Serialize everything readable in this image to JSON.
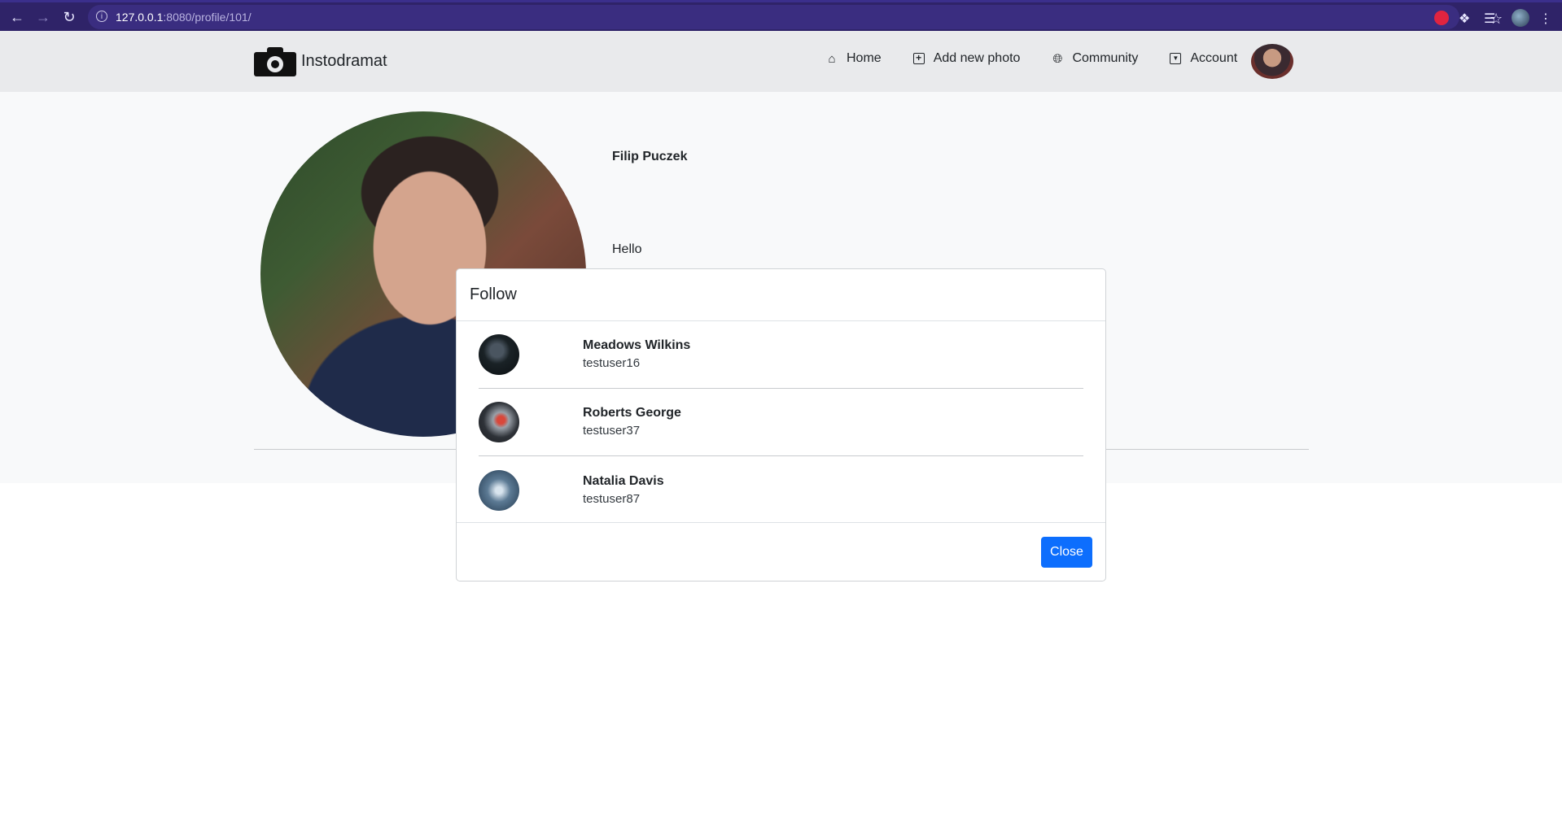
{
  "browser": {
    "url_host": "127.0.0.1",
    "url_rest": ":8080/profile/101/"
  },
  "site": {
    "brand": "Instodramat",
    "nav": {
      "home": "Home",
      "add_photo": "Add new photo",
      "community": "Community",
      "account": "Account"
    }
  },
  "profile": {
    "name": "Filip Puczek",
    "bio": "Hello"
  },
  "modal": {
    "title": "Follow",
    "users": [
      {
        "name": "Meadows Wilkins",
        "username": "testuser16"
      },
      {
        "name": "Roberts George",
        "username": "testuser37"
      },
      {
        "name": "Natalia Davis",
        "username": "testuser87"
      }
    ],
    "close_label": "Close"
  },
  "colors": {
    "browser_bar": "#2f2368",
    "navbar": "#e9eaec",
    "primary_button": "#0d6efd"
  }
}
